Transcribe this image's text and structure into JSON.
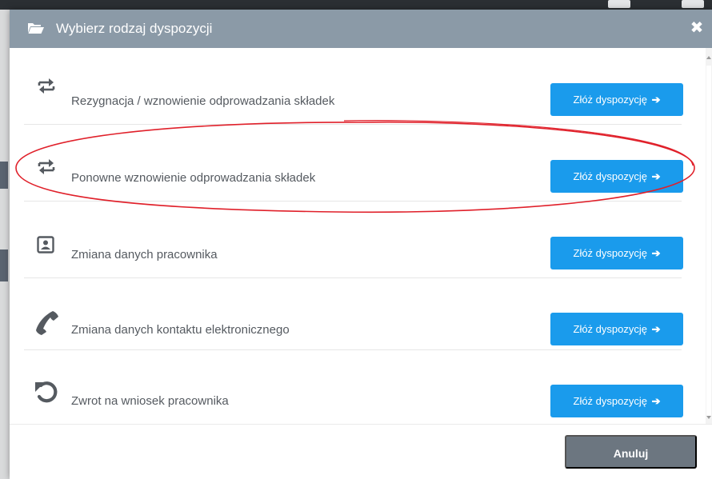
{
  "dialog": {
    "title": "Wybierz rodzaj dyspozycji",
    "close_icon": "close-icon",
    "header_icon": "folder-open-icon"
  },
  "options": [
    {
      "label": "Rezygnacja / wznowienie odprowadzania składek",
      "icon": "swap-arrows-icon",
      "button_label": "Złóż dyspozycję"
    },
    {
      "label": "Ponowne wznowienie odprowadzania składek",
      "icon": "swap-arrows-icon",
      "button_label": "Złóż dyspozycję"
    },
    {
      "label": "Zmiana danych pracownika",
      "icon": "id-card-icon",
      "button_label": "Złóż dyspozycję"
    },
    {
      "label": "Zmiana danych kontaktu elektronicznego",
      "icon": "phone-icon",
      "button_label": "Złóż dyspozycję"
    },
    {
      "label": "Zwrot na wniosek pracownika",
      "icon": "undo-icon",
      "button_label": "Złóż dyspozycję"
    }
  ],
  "footer": {
    "cancel_label": "Anuluj"
  },
  "colors": {
    "header_bg": "#8b9aa7",
    "primary_button": "#1a9bec",
    "cancel_button": "#6c7680",
    "highlight_annotation": "#e0202a"
  }
}
